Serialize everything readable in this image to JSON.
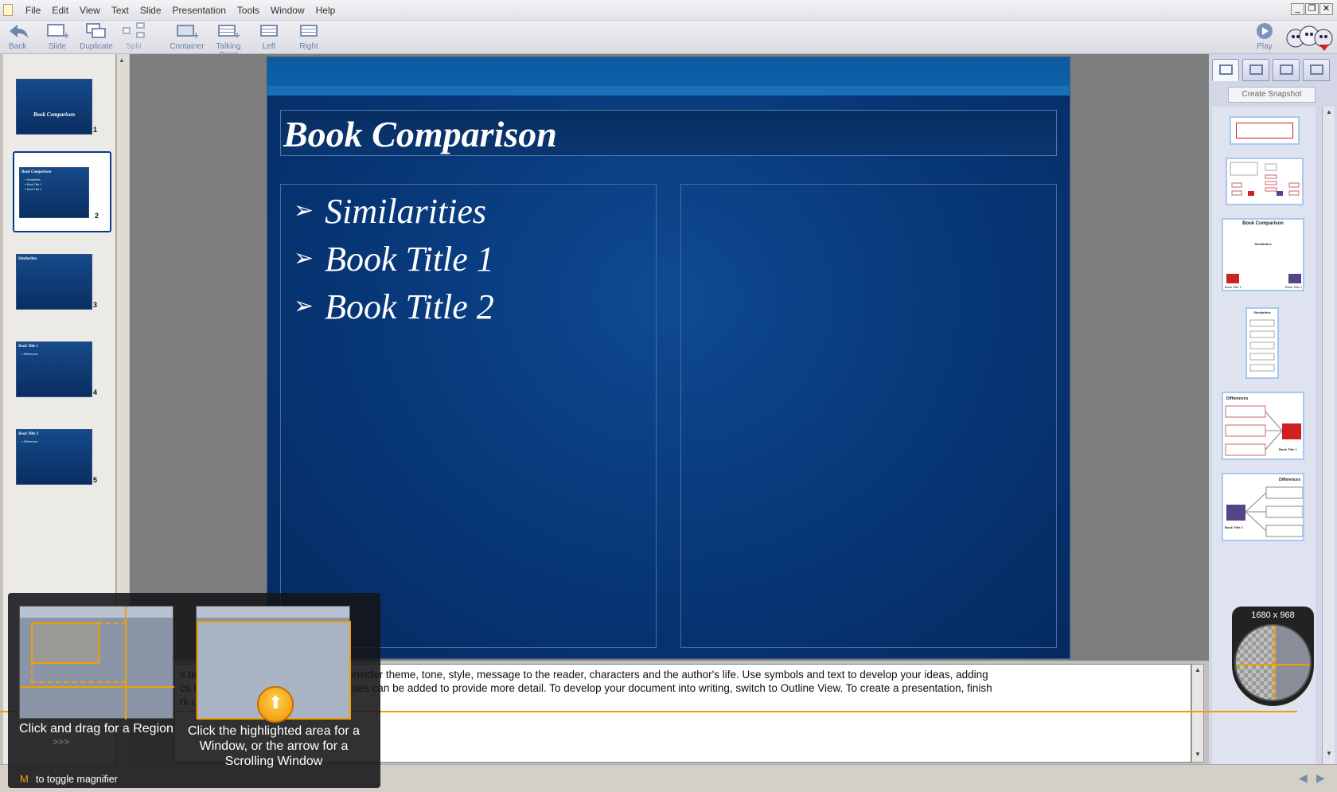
{
  "menubar": {
    "items": [
      "File",
      "Edit",
      "View",
      "Text",
      "Slide",
      "Presentation",
      "Tools",
      "Window",
      "Help"
    ]
  },
  "toolbar": {
    "back": "Back",
    "slide": "Slide",
    "duplicate": "Duplicate",
    "split": "Split",
    "container": "Container",
    "talking_point": "Talking Point",
    "left": "Left",
    "right": "Right",
    "play": "Play"
  },
  "slides": [
    {
      "num": "1",
      "title": "Book Comparison"
    },
    {
      "num": "2",
      "title": "Book Comparison",
      "lines": [
        "» Similarities",
        "» Book Title 1",
        "» Book Title 2"
      ]
    },
    {
      "num": "3",
      "title": "Similarities"
    },
    {
      "num": "4",
      "title": "Book Title 1",
      "lines": [
        "» Differences"
      ]
    },
    {
      "num": "5",
      "title": "Book Title 2",
      "lines": [
        "» Differences"
      ]
    }
  ],
  "slide": {
    "title": "Book Comparison",
    "bullets": [
      "Similarities",
      "Book Title 1",
      "Book Title 2"
    ]
  },
  "notes": {
    "line1": "s tem                                              wo books. You may want to consider theme, tone, style, message to the reader, characters and the author's life. Use symbols and text to develop your ideas, adding",
    "line2": "cs to                                              connections between ideas. Notes can be added to provide more detail. To develop your document into writing, switch to Outline View. To create a presentation, finish",
    "line3": "rk us"
  },
  "rightpane": {
    "create_snapshot": "Create Snapshot",
    "snap3_title": "Book Comparison",
    "snap3_sub": "Similarities",
    "snap3_b1": "Book Title 1",
    "snap3_b2": "Book Title 2",
    "snap4_title": "Similarities",
    "snap5_title": "Differences",
    "snap5_label": "Book Title 1",
    "snap6_title": "Differences",
    "snap6_label": "Book Title 2"
  },
  "capture": {
    "region_label": "Click and drag for a Region",
    "window_label": "Click the highlighted area for a Window, or the arrow for a Scrolling Window",
    "hint_key": "M",
    "hint_text": "to toggle magnifier",
    "arrows": ">>>"
  },
  "magnifier": {
    "dims": "1680 x 968"
  },
  "colors": {
    "slide_blue": "#073676",
    "accent_orange": "#f0a000"
  }
}
